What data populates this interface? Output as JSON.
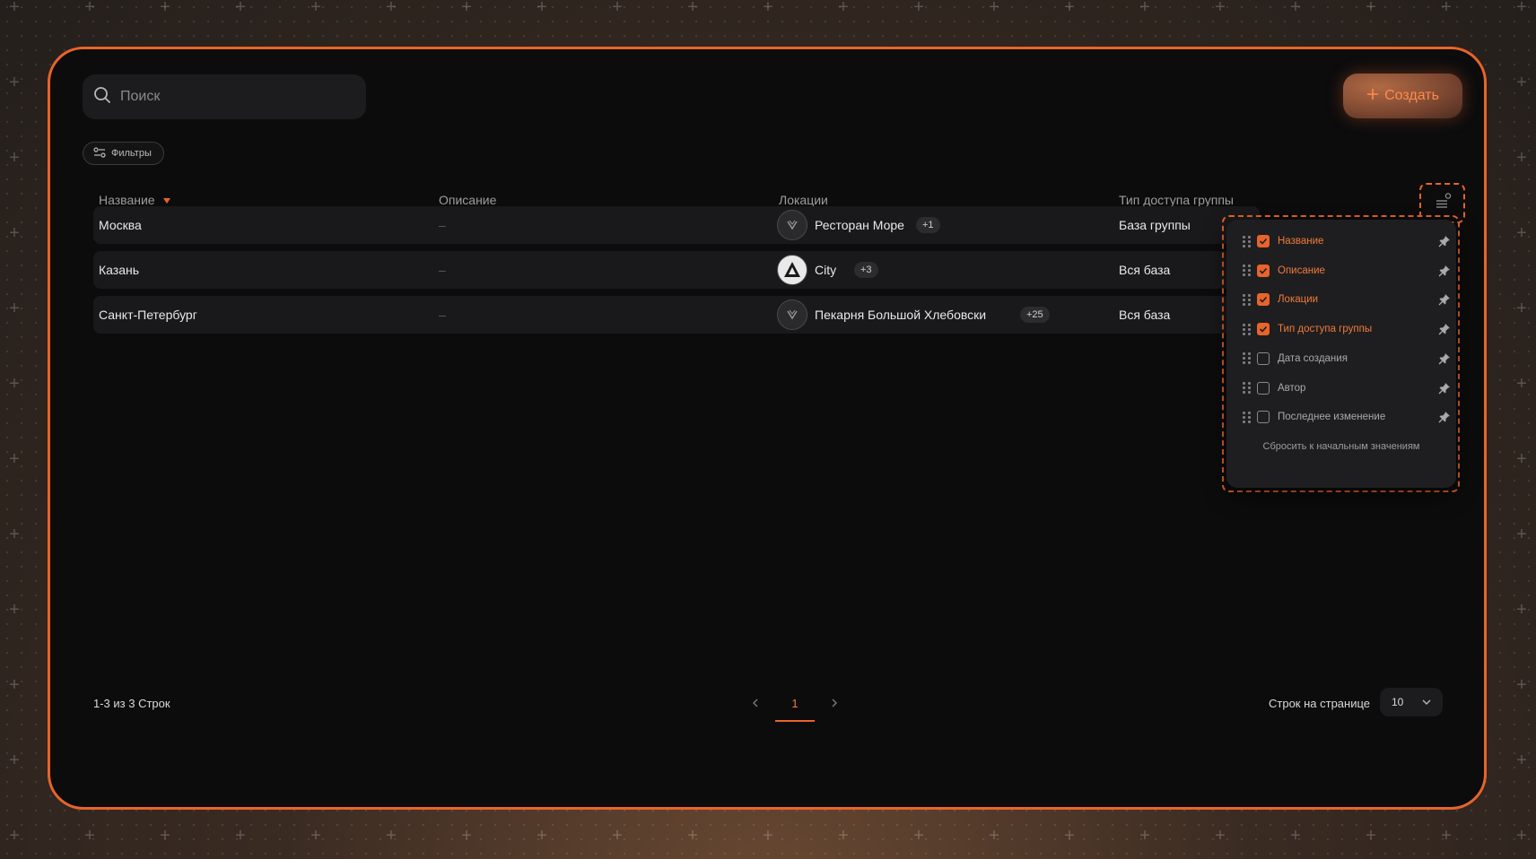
{
  "search": {
    "placeholder": "Поиск"
  },
  "toolbar": {
    "filters_label": "Фильтры",
    "create_label": "Создать"
  },
  "table": {
    "columns": [
      "Название",
      "Описание",
      "Локации",
      "Тип доступа группы"
    ],
    "sort_indicator": "desc",
    "rows": [
      {
        "name": "Москва",
        "description": "–",
        "location": "Ресторан Море",
        "location_extra": "+1",
        "access": "База группы"
      },
      {
        "name": "Казань",
        "description": "–",
        "location": "City",
        "location_extra": "+3",
        "access": "Вся база"
      },
      {
        "name": "Санкт-Петербург",
        "description": "–",
        "location": "Пекарня Большой Хлебовски",
        "location_extra": "+25",
        "access": "Вся база"
      }
    ]
  },
  "column_settings": {
    "options": [
      {
        "label": "Название",
        "checked": true
      },
      {
        "label": "Описание",
        "checked": true
      },
      {
        "label": "Локации",
        "checked": true
      },
      {
        "label": "Тип доступа группы",
        "checked": true
      },
      {
        "label": "Дата создания",
        "checked": false
      },
      {
        "label": "Автор",
        "checked": false
      },
      {
        "label": "Последнее изменение",
        "checked": false
      }
    ],
    "reset_label": "Сбросить к начальным значениям"
  },
  "pagination": {
    "summary": "1-3 из 3 Строк",
    "current_page": "1",
    "rows_per_page_label": "Строк на странице",
    "rows_per_page_value": "10"
  },
  "colors": {
    "accent": "#e8642a",
    "panel": "#0c0c0d",
    "row": "#19191b"
  }
}
